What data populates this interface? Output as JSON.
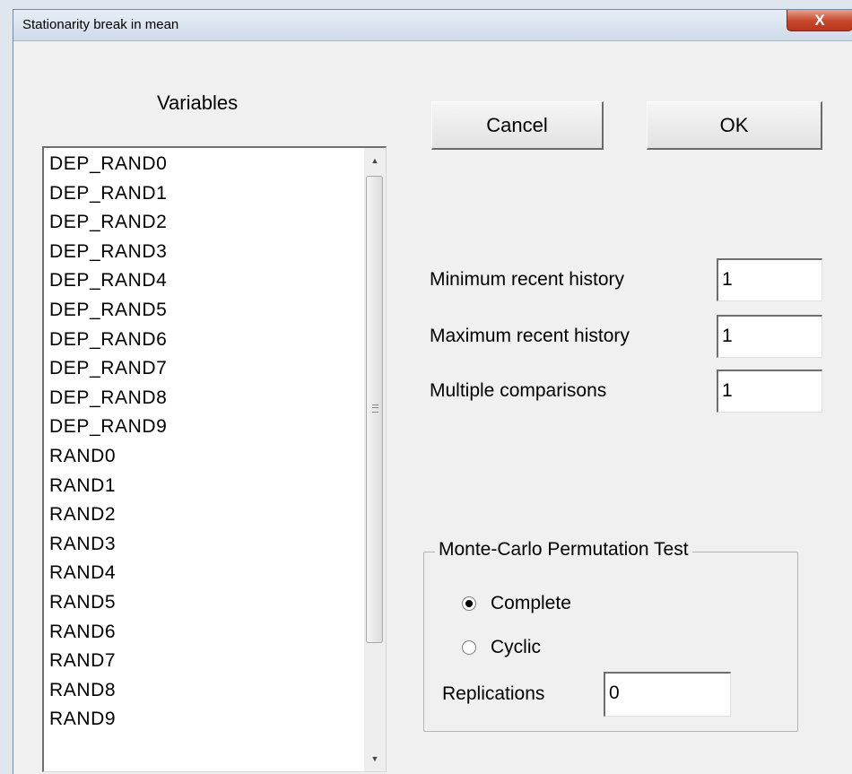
{
  "window": {
    "title": "Stationarity break in mean",
    "close_symbol": "X"
  },
  "variables": {
    "label": "Variables",
    "items": [
      "DEP_RAND0",
      "DEP_RAND1",
      "DEP_RAND2",
      "DEP_RAND3",
      "DEP_RAND4",
      "DEP_RAND5",
      "DEP_RAND6",
      "DEP_RAND7",
      "DEP_RAND8",
      "DEP_RAND9",
      "RAND0",
      "RAND1",
      "RAND2",
      "RAND3",
      "RAND4",
      "RAND5",
      "RAND6",
      "RAND7",
      "RAND8",
      "RAND9"
    ]
  },
  "buttons": {
    "cancel": "Cancel",
    "ok": "OK"
  },
  "fields": {
    "min_history": {
      "label": "Minimum recent history",
      "value": "1"
    },
    "max_history": {
      "label": "Maximum recent history",
      "value": "1"
    },
    "multiple_comparisons": {
      "label": "Multiple comparisons",
      "value": "1"
    }
  },
  "monte_carlo": {
    "title": "Monte-Carlo Permutation Test",
    "options": [
      {
        "label": "Complete",
        "selected": true
      },
      {
        "label": "Cyclic",
        "selected": false
      }
    ],
    "replications": {
      "label": "Replications",
      "value": "0"
    }
  },
  "icons": {
    "scroll_up": "up-arrow-icon",
    "scroll_down": "down-arrow-icon",
    "scroll_grip": "grip-icon",
    "close": "close-icon"
  }
}
